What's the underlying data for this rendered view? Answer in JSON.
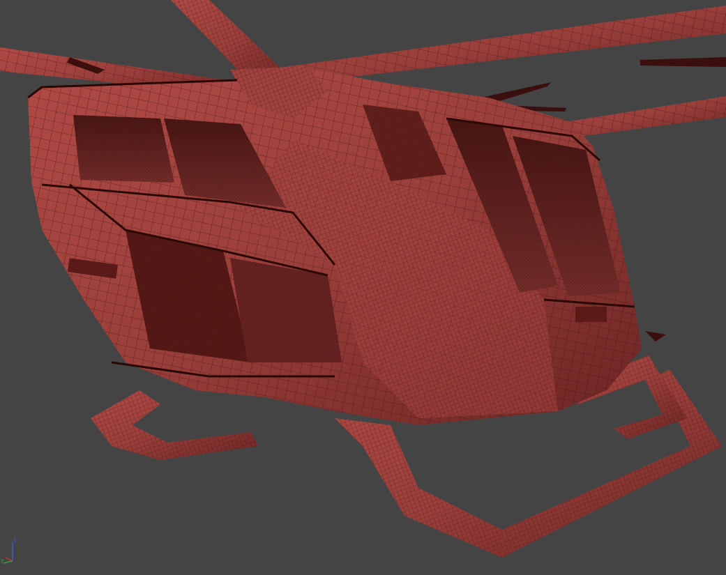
{
  "viewport": {
    "background": "#444444",
    "mesh_color": "#9a3f3b",
    "wire_color": "#3a0f0d",
    "shadow_color": "#5a1a17"
  },
  "axis_gizmo": {
    "z_label": "z",
    "x_label": "x",
    "y_label": "y",
    "z_color": "#3a5fd8",
    "x_color": "#c23a2a",
    "y_color": "#3aa03a"
  }
}
